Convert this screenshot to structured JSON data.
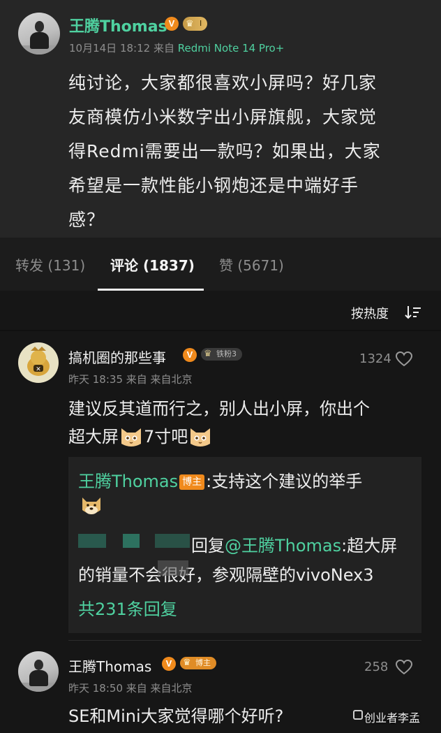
{
  "post": {
    "author": "王腾Thomas",
    "verified_mark": "V",
    "level_badge": "I",
    "time": "10月14日 18:12",
    "from_label": "来自",
    "device": "Redmi Note 14 Pro+",
    "lines": [
      "纯讨论，大家都很喜欢小屏吗？好几家",
      "友商模仿小米数字出小屏旗舰，大家觉",
      "得Redmi需要出一款吗？如果出，大家",
      "希望是一款性能小钢炮还是中端好手",
      "感？"
    ]
  },
  "tabs": [
    {
      "label": "转发 (131)"
    },
    {
      "label": "评论 (1837)"
    },
    {
      "label": "赞 (5671)"
    }
  ],
  "sort": {
    "label": "按热度"
  },
  "comments": [
    {
      "author": "搞机圈的那些事",
      "verified_mark": "V",
      "level_badge": "铁粉3",
      "time": "昨天 18:35 来自 来自北京",
      "likes": "1324",
      "line1": "建议反其道而行之，别人出小屏，你出个",
      "line2_a": "超大屏",
      "line2_b": "7寸吧",
      "replies": {
        "r1_name": "王腾Thomas",
        "r1_badge": "博主",
        "r1_text": ":支持这个建议的举手",
        "r2_prefix": "回复",
        "r2_mention": "@王腾Thomas",
        "r2_text": ":超大屏",
        "r2_line2": "的销量不会很好，参观隔壁的vivoNex3",
        "more": "共231条回复"
      }
    },
    {
      "author": "王腾Thomas",
      "verified_mark": "V",
      "level_badge": "博主",
      "time": "昨天 18:50 来自 来自北京",
      "likes": "258",
      "text": "SE和Mini大家觉得哪个好听?"
    }
  ],
  "watermark": "创业者李孟",
  "colors": {
    "accent": "#4fd1a0",
    "background": "#161616",
    "card": "#262626",
    "badge": "#f08a1c"
  }
}
